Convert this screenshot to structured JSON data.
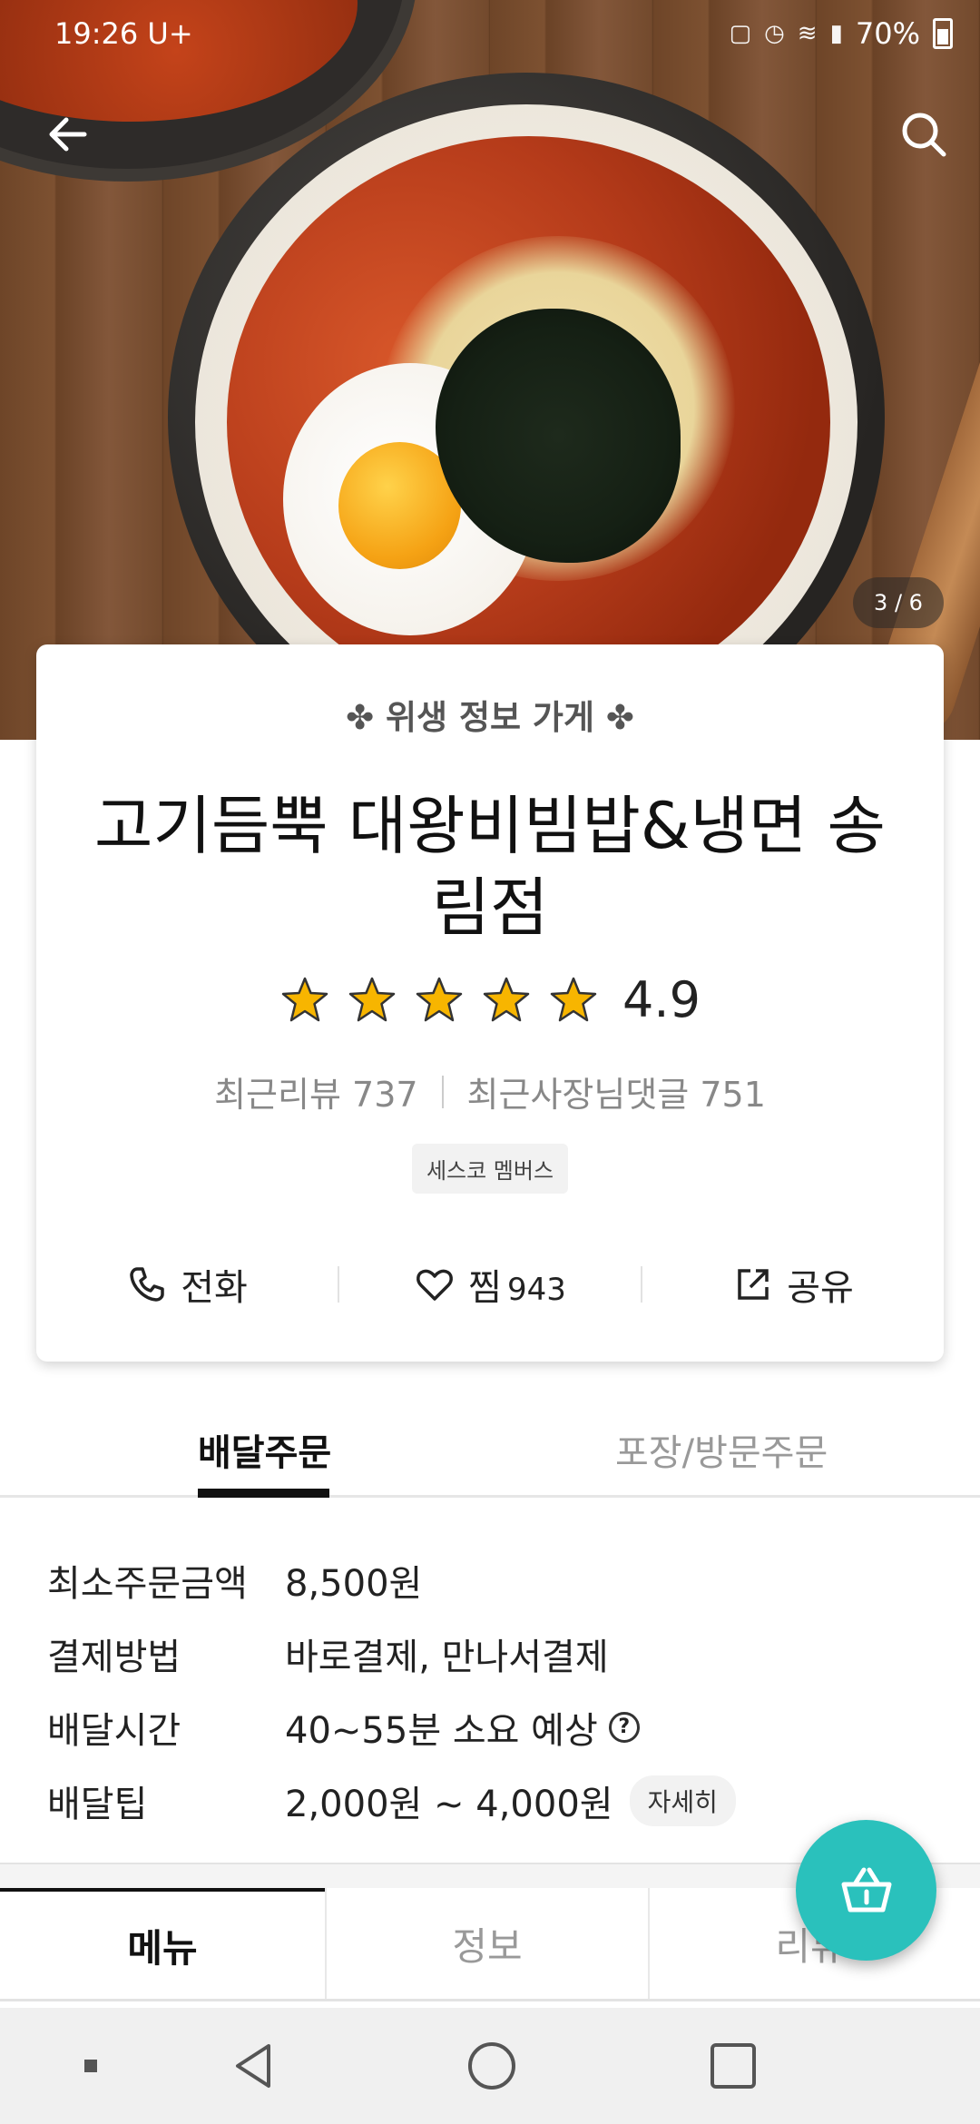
{
  "status_bar": {
    "time": "19:26",
    "carrier": "U+",
    "battery": "70%"
  },
  "hero": {
    "image_counter": "3 / 6"
  },
  "store": {
    "hygiene_label": "위생 정보 가게",
    "name": "고기듬뿍 대왕비빔밥&냉면 송림점",
    "rating": "4.9",
    "stars": 5,
    "recent_reviews": "최근리뷰 737",
    "owner_replies": "최근사장님댓글 751",
    "badge": "세스코 멤버스"
  },
  "actions": {
    "call": "전화",
    "like": "찜",
    "like_count": "943",
    "share": "공유"
  },
  "order_tabs": {
    "delivery": "배달주문",
    "pickup": "포장/방문주문"
  },
  "delivery_info": [
    {
      "label": "최소주문금액",
      "value": "8,500원"
    },
    {
      "label": "결제방법",
      "value": "바로결제, 만나서결제"
    },
    {
      "label": "배달시간",
      "value": "40~55분 소요 예상"
    },
    {
      "label": "배달팁",
      "value": "2,000원 ~ 4,000원",
      "detail": "자세히"
    }
  ],
  "tabs": {
    "menu": "메뉴",
    "info": "정보",
    "reviews": "리뷰"
  },
  "colors": {
    "accent": "#2ac1bc",
    "star": "#f7b500"
  },
  "icons": [
    "back-arrow-icon",
    "search-icon",
    "phone-icon",
    "heart-icon",
    "share-icon",
    "question-icon",
    "cart-icon"
  ]
}
